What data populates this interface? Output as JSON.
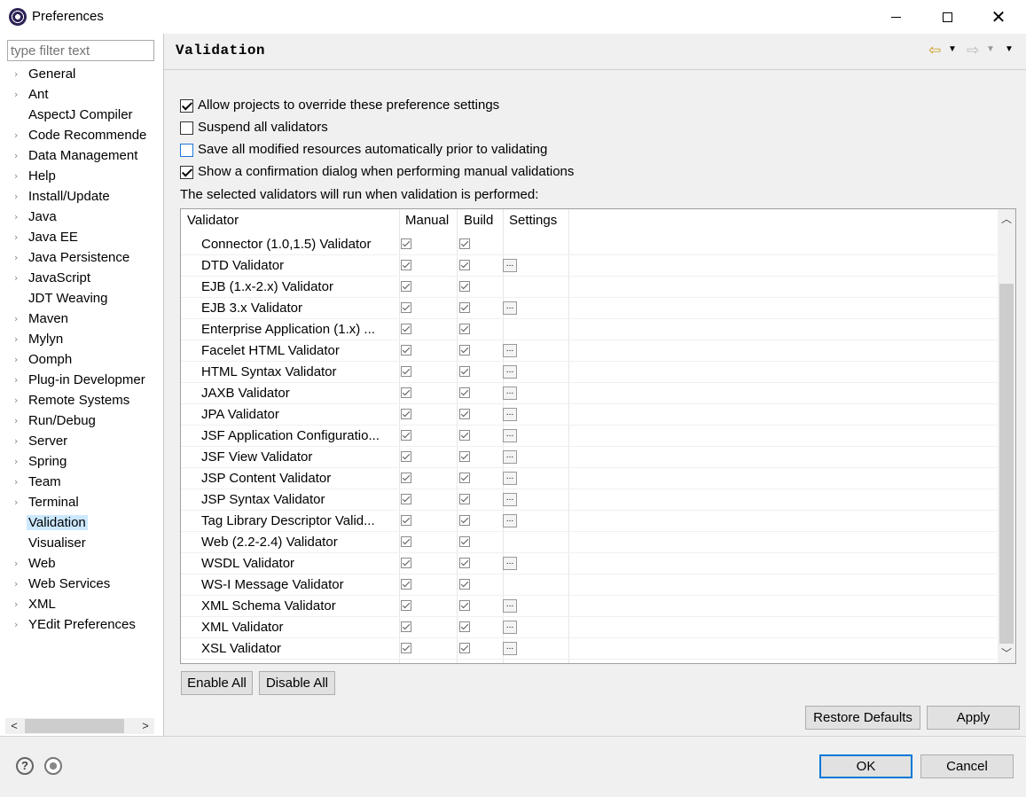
{
  "window": {
    "title": "Preferences"
  },
  "sidebar": {
    "filter_placeholder": "type filter text",
    "items": [
      {
        "label": "General",
        "expandable": true
      },
      {
        "label": "Ant",
        "expandable": true
      },
      {
        "label": "AspectJ Compiler",
        "expandable": false
      },
      {
        "label": "Code Recommende",
        "expandable": true
      },
      {
        "label": "Data Management",
        "expandable": true
      },
      {
        "label": "Help",
        "expandable": true
      },
      {
        "label": "Install/Update",
        "expandable": true
      },
      {
        "label": "Java",
        "expandable": true
      },
      {
        "label": "Java EE",
        "expandable": true
      },
      {
        "label": "Java Persistence",
        "expandable": true
      },
      {
        "label": "JavaScript",
        "expandable": true
      },
      {
        "label": "JDT Weaving",
        "expandable": false
      },
      {
        "label": "Maven",
        "expandable": true
      },
      {
        "label": "Mylyn",
        "expandable": true
      },
      {
        "label": "Oomph",
        "expandable": true
      },
      {
        "label": "Plug-in Developmer",
        "expandable": true
      },
      {
        "label": "Remote Systems",
        "expandable": true
      },
      {
        "label": "Run/Debug",
        "expandable": true
      },
      {
        "label": "Server",
        "expandable": true
      },
      {
        "label": "Spring",
        "expandable": true
      },
      {
        "label": "Team",
        "expandable": true
      },
      {
        "label": "Terminal",
        "expandable": true
      },
      {
        "label": "Validation",
        "expandable": false,
        "selected": true
      },
      {
        "label": "Visualiser",
        "expandable": false
      },
      {
        "label": "Web",
        "expandable": true
      },
      {
        "label": "Web Services",
        "expandable": true
      },
      {
        "label": "XML",
        "expandable": true
      },
      {
        "label": "YEdit Preferences",
        "expandable": true
      }
    ]
  },
  "page": {
    "title": "Validation",
    "options": [
      {
        "label": "Allow projects to override these preference settings",
        "checked": true
      },
      {
        "label": "Suspend all validators",
        "checked": false
      },
      {
        "label": "Save all modified resources automatically prior to validating",
        "checked": false
      },
      {
        "label": "Show a confirmation dialog when performing manual validations",
        "checked": true
      }
    ],
    "description": "The selected validators will run when validation is performed:",
    "table": {
      "headers": {
        "validator": "Validator",
        "manual": "Manual",
        "build": "Build",
        "settings": "Settings"
      },
      "rows": [
        {
          "name": "Connector (1.0,1.5) Validator",
          "manual": true,
          "build": true,
          "settings": false
        },
        {
          "name": "DTD Validator",
          "manual": true,
          "build": true,
          "settings": true
        },
        {
          "name": "EJB (1.x-2.x) Validator",
          "manual": true,
          "build": true,
          "settings": false
        },
        {
          "name": "EJB 3.x Validator",
          "manual": true,
          "build": true,
          "settings": true
        },
        {
          "name": "Enterprise Application (1.x) ...",
          "manual": true,
          "build": true,
          "settings": false
        },
        {
          "name": "Facelet HTML Validator",
          "manual": true,
          "build": true,
          "settings": true
        },
        {
          "name": "HTML Syntax Validator",
          "manual": true,
          "build": true,
          "settings": true
        },
        {
          "name": "JAXB Validator",
          "manual": true,
          "build": true,
          "settings": true
        },
        {
          "name": "JPA Validator",
          "manual": true,
          "build": true,
          "settings": true
        },
        {
          "name": "JSF Application Configuratio...",
          "manual": true,
          "build": true,
          "settings": true
        },
        {
          "name": "JSF View Validator",
          "manual": true,
          "build": true,
          "settings": true
        },
        {
          "name": "JSP Content Validator",
          "manual": true,
          "build": true,
          "settings": true
        },
        {
          "name": "JSP Syntax Validator",
          "manual": true,
          "build": true,
          "settings": true
        },
        {
          "name": "Tag Library Descriptor Valid...",
          "manual": true,
          "build": true,
          "settings": true
        },
        {
          "name": "Web (2.2-2.4) Validator",
          "manual": true,
          "build": true,
          "settings": false
        },
        {
          "name": "WSDL Validator",
          "manual": true,
          "build": true,
          "settings": true
        },
        {
          "name": "WS-I Message Validator",
          "manual": true,
          "build": true,
          "settings": false
        },
        {
          "name": "XML Schema Validator",
          "manual": true,
          "build": true,
          "settings": true
        },
        {
          "name": "XML Validator",
          "manual": true,
          "build": true,
          "settings": true
        },
        {
          "name": "XSL Validator",
          "manual": true,
          "build": true,
          "settings": true
        }
      ],
      "settings_glyph": "..."
    },
    "buttons": {
      "enable_all": "Enable All",
      "disable_all": "Disable All",
      "restore_defaults": "Restore Defaults",
      "apply": "Apply"
    }
  },
  "footer": {
    "ok": "OK",
    "cancel": "Cancel"
  },
  "icons": {
    "app": "eclipse-icon",
    "back": "back-arrow-icon",
    "forward": "forward-arrow-icon",
    "help": "help-icon",
    "oomph": "oomph-record-icon"
  },
  "colors": {
    "selection": "#cce8ff",
    "focus": "#0078d7",
    "nav_back": "#c89a1c"
  }
}
